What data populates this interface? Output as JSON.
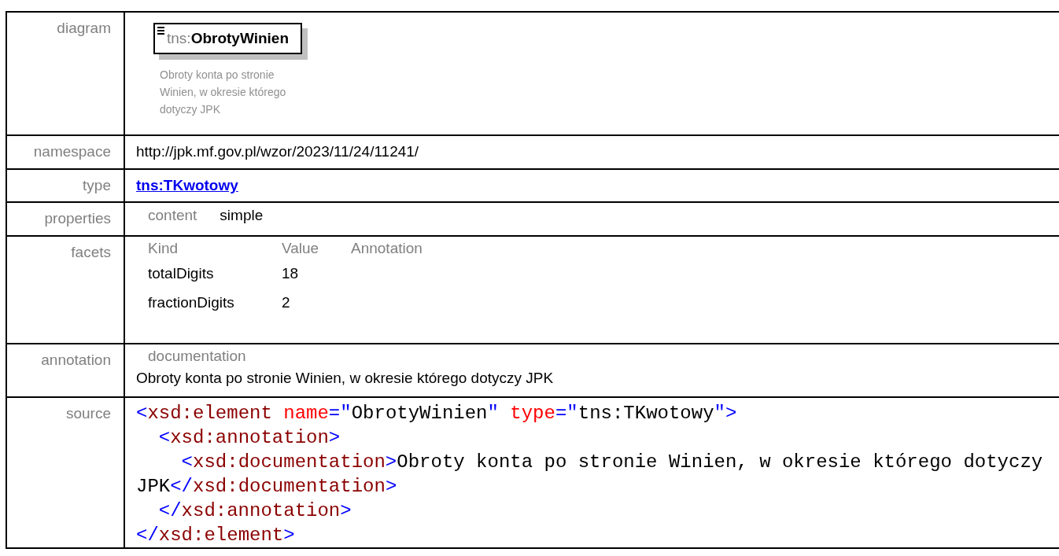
{
  "rows": [
    {
      "label": "diagram",
      "kind": "diagram",
      "prefix": "tns:",
      "name": "ObrotyWinien",
      "note": "Obroty konta po stronie Winien, w okresie którego dotyczy JPK"
    },
    {
      "label": "namespace",
      "kind": "text",
      "value": "http://jpk.mf.gov.pl/wzor/2023/11/24/11241/"
    },
    {
      "label": "type",
      "kind": "link",
      "value": "tns:TKwotowy"
    },
    {
      "label": "properties",
      "kind": "pairs",
      "pairs": [
        {
          "key": "content",
          "value": "simple"
        }
      ]
    },
    {
      "label": "facets",
      "kind": "facets",
      "headings": [
        "Kind",
        "Value",
        "Annotation"
      ],
      "facets": [
        {
          "kind_name": "totalDigits",
          "value": "18"
        },
        {
          "kind_name": "fractionDigits",
          "value": "2"
        }
      ]
    },
    {
      "label": "annotation",
      "kind": "annotation",
      "heading": "documentation",
      "text": "Obroty konta po stronie Winien, w okresie którego dotyczy JPK"
    },
    {
      "label": "source",
      "kind": "code",
      "lines": [
        [
          {
            "kind": "bracket",
            "text": "<"
          },
          {
            "kind": "tag",
            "text": "xsd:element"
          },
          {
            "kind": "attr",
            "text": " name"
          },
          {
            "kind": "bracket",
            "text": "=\""
          },
          {
            "kind": "value",
            "text": "ObrotyWinien"
          },
          {
            "kind": "bracket",
            "text": "\""
          },
          {
            "kind": "attr",
            "text": " type"
          },
          {
            "kind": "bracket",
            "text": "=\""
          },
          {
            "kind": "value",
            "text": "tns:TKwotowy"
          },
          {
            "kind": "bracket",
            "text": "\">"
          }
        ],
        [
          {
            "kind": "bracket",
            "text": "  <"
          },
          {
            "kind": "tag",
            "text": "xsd:annotation"
          },
          {
            "kind": "bracket",
            "text": ">"
          }
        ],
        [
          {
            "kind": "bracket",
            "text": "    <"
          },
          {
            "kind": "tag",
            "text": "xsd:documentation"
          },
          {
            "kind": "bracket",
            "text": ">"
          },
          {
            "kind": "value",
            "text": "Obroty konta po stronie Winien, w okresie którego dotyczy"
          }
        ],
        [
          {
            "kind": "value",
            "text": "JPK"
          },
          {
            "kind": "bracket",
            "text": "</"
          },
          {
            "kind": "tag",
            "text": "xsd:documentation"
          },
          {
            "kind": "bracket",
            "text": ">"
          }
        ],
        [
          {
            "kind": "bracket",
            "text": "  </"
          },
          {
            "kind": "tag",
            "text": "xsd:annotation"
          },
          {
            "kind": "bracket",
            "text": ">"
          }
        ],
        [
          {
            "kind": "bracket",
            "text": "</"
          },
          {
            "kind": "tag",
            "text": "xsd:element"
          },
          {
            "kind": "bracket",
            "text": ">"
          }
        ]
      ]
    }
  ]
}
